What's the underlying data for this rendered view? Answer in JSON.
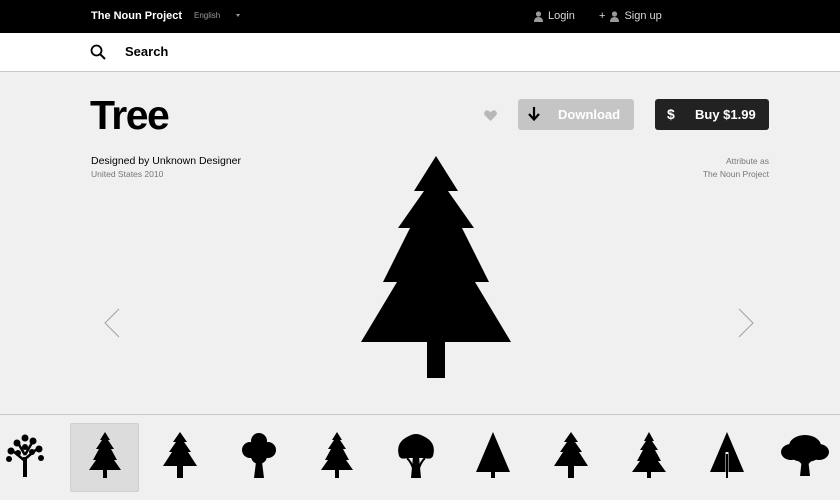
{
  "topbar": {
    "brand": "The Noun Project",
    "language": "English",
    "login": "Login",
    "signup_plus": "+",
    "signup": "Sign up"
  },
  "search": {
    "label": "Search",
    "icon": "search-icon"
  },
  "icon_page": {
    "title": "Tree",
    "designer": "Designed by Unknown Designer",
    "meta": "United States 2010",
    "attribute_line1": "Attribute as",
    "attribute_line2": "The Noun Project",
    "download_label": "Download",
    "buy_symbol": "$",
    "buy_label": "Buy $1.99"
  },
  "colors": {
    "topbar_bg": "#000000",
    "download_bg": "#c5c5c5",
    "buy_bg": "#222222",
    "page_bg": "#f0f0f0"
  },
  "thumbnails": [
    {
      "icon": "oak-tree-icon",
      "selected": false
    },
    {
      "icon": "pine-tree-icon",
      "selected": true
    },
    {
      "icon": "pine-tree-icon",
      "selected": false
    },
    {
      "icon": "round-tree-icon",
      "selected": false
    },
    {
      "icon": "pine-tree-icon",
      "selected": false
    },
    {
      "icon": "mushroom-tree-icon",
      "selected": false
    },
    {
      "icon": "cone-tree-icon",
      "selected": false
    },
    {
      "icon": "pine-tree-icon",
      "selected": false
    },
    {
      "icon": "pine-tree-icon",
      "selected": false
    },
    {
      "icon": "split-cone-tree-icon",
      "selected": false
    },
    {
      "icon": "oak-silhouette-icon",
      "selected": false
    }
  ]
}
